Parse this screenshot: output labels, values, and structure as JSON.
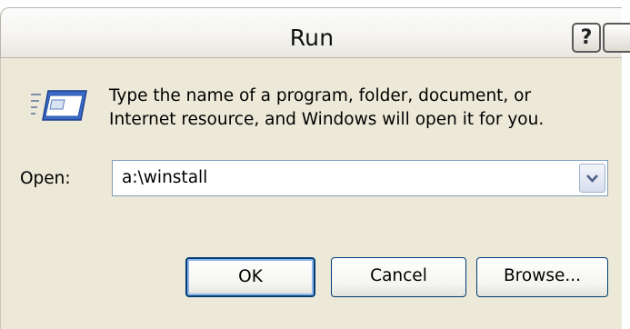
{
  "window": {
    "title": "Run",
    "help_label": "?"
  },
  "description": "Type the name of a program, folder, document, or\nInternet resource, and Windows will open it for you.",
  "open": {
    "label": "Open:",
    "value": "a:\\winstall"
  },
  "buttons": {
    "ok": "OK",
    "cancel": "Cancel",
    "browse": "Browse..."
  },
  "icons": {
    "run": "run-icon",
    "dropdown": "chevron-down-icon",
    "help": "help-icon",
    "close": "close-icon"
  },
  "colors": {
    "dialog_face": "#ece9d8",
    "button_border": "#003c74",
    "input_border": "#7f9db9"
  }
}
